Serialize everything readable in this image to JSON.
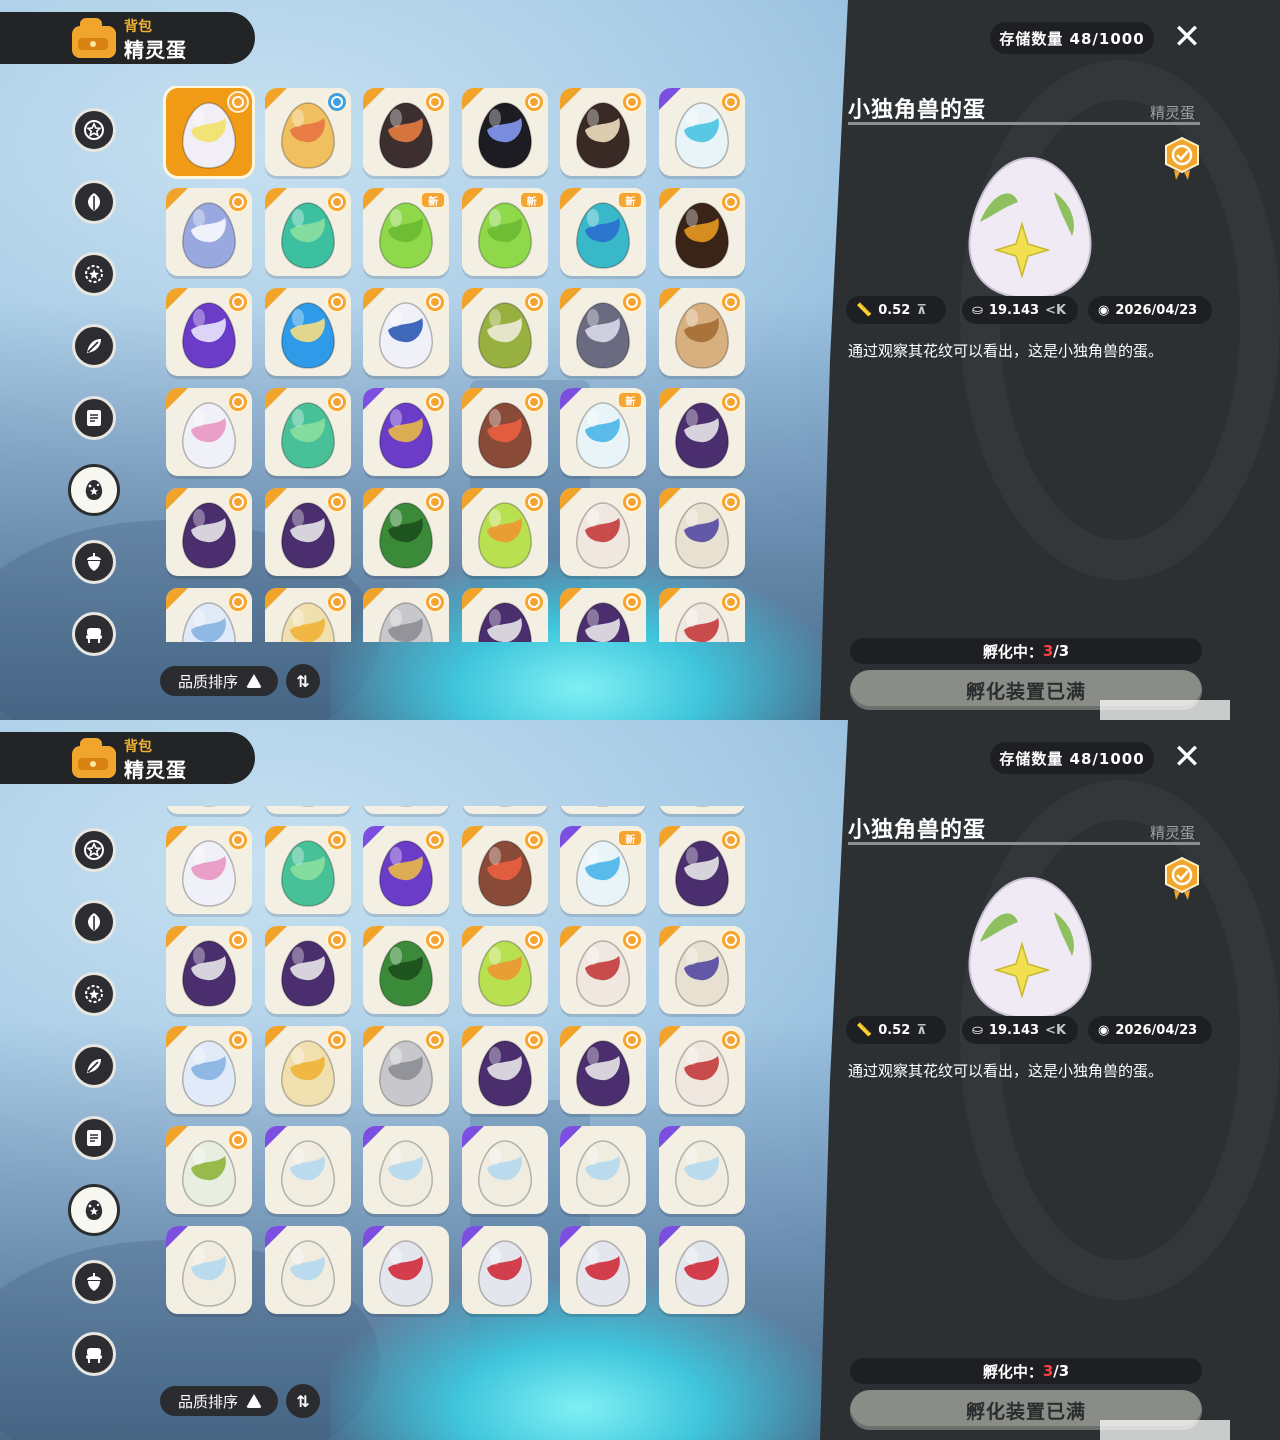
{
  "header": {
    "sub": "背包",
    "title": "精灵蛋"
  },
  "nav": [
    "star-badge",
    "leaf",
    "sun-star",
    "herb",
    "scroll",
    "egg",
    "acorn",
    "chair"
  ],
  "sort": {
    "label": "品质排序"
  },
  "panel": {
    "storage": "存储数量 48/1000",
    "egg_name": "小独角兽的蛋",
    "category": "精灵蛋",
    "size": "0.52",
    "weight": "19.143",
    "date": "2026/04/23",
    "description": "通过观察其花纹可以看出，这是小独角兽的蛋。",
    "hatching_label": "孵化中：",
    "hatching_current": "3",
    "hatching_total": "/3",
    "full_button": "孵化装置已满"
  },
  "screens": [
    {
      "rows": [
        [
          {
            "c": "#f1eef6",
            "s": "#f2e060",
            "m": "o",
            "k": "none"
          },
          {
            "c": "#f0c060",
            "s": "#e87040",
            "m": "b",
            "k": "o"
          },
          {
            "c": "#3d2e30",
            "s": "#f08040",
            "m": "o",
            "k": "o"
          },
          {
            "c": "#1c1c22",
            "s": "#8aa0ff",
            "m": "o",
            "k": "o"
          },
          {
            "c": "#3a2a26",
            "s": "#f8e8c8",
            "m": "o",
            "k": "o"
          },
          {
            "c": "#e8f4f8",
            "s": "#40c0e0",
            "m": "o",
            "k": "p"
          }
        ],
        [
          {
            "c": "#9aa8e0",
            "s": "#ffffff",
            "m": "o",
            "k": "o"
          },
          {
            "c": "#3cc0a0",
            "s": "#8fe0a0",
            "m": "o",
            "k": "o"
          },
          {
            "c": "#8fd84a",
            "s": "#6ab830",
            "m": "n",
            "k": "o"
          },
          {
            "c": "#8fd84a",
            "s": "#6ab830",
            "m": "n",
            "k": "o"
          },
          {
            "c": "#38b8c8",
            "s": "#2a6ad0",
            "m": "n",
            "k": "o"
          },
          {
            "c": "#3a2418",
            "s": "#f0a020",
            "m": "o",
            "k": "o"
          }
        ],
        [
          {
            "c": "#6a3cc8",
            "s": "#f0f0ff",
            "m": "o",
            "k": "o"
          },
          {
            "c": "#2f9ae8",
            "s": "#ffe080",
            "m": "o",
            "k": "o"
          },
          {
            "c": "#f0f0f8",
            "s": "#2050b0",
            "m": "o",
            "k": "o"
          },
          {
            "c": "#98b040",
            "s": "#f0f0e0",
            "m": "o",
            "k": "o"
          },
          {
            "c": "#6a6a80",
            "s": "#e0e0f0",
            "m": "o",
            "k": "o"
          },
          {
            "c": "#d8b080",
            "s": "#a06a30",
            "m": "o",
            "k": "o"
          }
        ],
        [
          {
            "c": "#f0f0f8",
            "s": "#e890c0",
            "m": "o",
            "k": "o"
          },
          {
            "c": "#48c098",
            "s": "#8fe0a0",
            "m": "o",
            "k": "o"
          },
          {
            "c": "#6a3cc8",
            "s": "#f0c040",
            "m": "o",
            "k": "p"
          },
          {
            "c": "#8a4a38",
            "s": "#f06040",
            "m": "o",
            "k": "o"
          },
          {
            "c": "#e8f4f8",
            "s": "#40b0e8",
            "m": "n",
            "k": "p"
          },
          {
            "c": "#4a2e6e",
            "s": "#f0f0f0",
            "m": "o",
            "k": "o"
          }
        ],
        [
          {
            "c": "#4a2e6e",
            "s": "#f0f0f0",
            "m": "o",
            "k": "o"
          },
          {
            "c": "#4a2e6e",
            "s": "#f0f0f0",
            "m": "o",
            "k": "o"
          },
          {
            "c": "#3a8a3a",
            "s": "#1a4a1a",
            "m": "o",
            "k": "o"
          },
          {
            "c": "#b8e050",
            "s": "#f09030",
            "m": "o",
            "k": "o"
          },
          {
            "c": "#f0e8e0",
            "s": "#c03030",
            "m": "o",
            "k": "o"
          },
          {
            "c": "#e8e0d0",
            "s": "#4a40a0",
            "m": "o",
            "k": "o"
          }
        ],
        [
          {
            "c": "#e0eaf8",
            "s": "#80b0e0",
            "m": "o",
            "k": "o"
          },
          {
            "c": "#f0e0b0",
            "s": "#f0b030",
            "m": "o",
            "k": "o"
          },
          {
            "c": "#c8c8cc",
            "s": "#8a8a90",
            "m": "o",
            "k": "o"
          },
          {
            "c": "#4a2e6e",
            "s": "#f0f0f0",
            "m": "o",
            "k": "o"
          },
          {
            "c": "#4a2e6e",
            "s": "#f0f0f0",
            "m": "o",
            "k": "o"
          },
          {
            "c": "#f0e8e0",
            "s": "#c03030",
            "m": "o",
            "k": "o"
          }
        ]
      ]
    },
    {
      "rows": [
        [
          {
            "c": "#6a3cc8",
            "s": "#f0f0ff",
            "m": "none",
            "k": "none"
          },
          {
            "c": "#2f9ae8",
            "s": "#ffe080",
            "m": "none",
            "k": "none"
          },
          {
            "c": "#f0f0f8",
            "s": "#2050b0",
            "m": "none",
            "k": "none"
          },
          {
            "c": "#98b040",
            "s": "#f0f0e0",
            "m": "none",
            "k": "none"
          },
          {
            "c": "#6a6a80",
            "s": "#e0e0f0",
            "m": "none",
            "k": "none"
          },
          {
            "c": "#d8b080",
            "s": "#a06a30",
            "m": "none",
            "k": "none"
          }
        ],
        [
          {
            "c": "#f0f0f8",
            "s": "#e890c0",
            "m": "o",
            "k": "o"
          },
          {
            "c": "#48c098",
            "s": "#8fe0a0",
            "m": "o",
            "k": "o"
          },
          {
            "c": "#6a3cc8",
            "s": "#f0c040",
            "m": "o",
            "k": "p"
          },
          {
            "c": "#8a4a38",
            "s": "#f06040",
            "m": "o",
            "k": "o"
          },
          {
            "c": "#e8f4f8",
            "s": "#40b0e8",
            "m": "n",
            "k": "p"
          },
          {
            "c": "#4a2e6e",
            "s": "#f0f0f0",
            "m": "o",
            "k": "o"
          }
        ],
        [
          {
            "c": "#4a2e6e",
            "s": "#f0f0f0",
            "m": "o",
            "k": "o"
          },
          {
            "c": "#4a2e6e",
            "s": "#f0f0f0",
            "m": "o",
            "k": "o"
          },
          {
            "c": "#3a8a3a",
            "s": "#1a4a1a",
            "m": "o",
            "k": "o"
          },
          {
            "c": "#b8e050",
            "s": "#f09030",
            "m": "o",
            "k": "o"
          },
          {
            "c": "#f0e8e0",
            "s": "#c03030",
            "m": "o",
            "k": "o"
          },
          {
            "c": "#e8e0d0",
            "s": "#4a40a0",
            "m": "o",
            "k": "o"
          }
        ],
        [
          {
            "c": "#e0eaf8",
            "s": "#80b0e0",
            "m": "o",
            "k": "o"
          },
          {
            "c": "#f0e0b0",
            "s": "#f0b030",
            "m": "o",
            "k": "o"
          },
          {
            "c": "#c8c8cc",
            "s": "#8a8a90",
            "m": "o",
            "k": "o"
          },
          {
            "c": "#4a2e6e",
            "s": "#f0f0f0",
            "m": "o",
            "k": "o"
          },
          {
            "c": "#4a2e6e",
            "s": "#f0f0f0",
            "m": "o",
            "k": "o"
          },
          {
            "c": "#f0e8e0",
            "s": "#c03030",
            "m": "o",
            "k": "o"
          }
        ],
        [
          {
            "c": "#e8eee0",
            "s": "#8ab030",
            "m": "o",
            "k": "o"
          },
          {
            "c": "#f0ece0",
            "s": "#b0d8f0",
            "m": "none",
            "k": "p"
          },
          {
            "c": "#f0ece0",
            "s": "#b0d8f0",
            "m": "none",
            "k": "p"
          },
          {
            "c": "#f0ece0",
            "s": "#b0d8f0",
            "m": "none",
            "k": "p"
          },
          {
            "c": "#f0ece0",
            "s": "#b0d8f0",
            "m": "none",
            "k": "p"
          },
          {
            "c": "#f0ece0",
            "s": "#b0d8f0",
            "m": "none",
            "k": "p"
          }
        ],
        [
          {
            "c": "#f0ece0",
            "s": "#b0d8f0",
            "m": "none",
            "k": "p"
          },
          {
            "c": "#f0ece0",
            "s": "#b0d8f0",
            "m": "none",
            "k": "p"
          },
          {
            "c": "#e4e6ee",
            "s": "#d02030",
            "m": "none",
            "k": "p"
          },
          {
            "c": "#e4e6ee",
            "s": "#d02030",
            "m": "none",
            "k": "p"
          },
          {
            "c": "#e4e6ee",
            "s": "#d02030",
            "m": "none",
            "k": "p"
          },
          {
            "c": "#e4e6ee",
            "s": "#d02030",
            "m": "none",
            "k": "p"
          }
        ]
      ]
    }
  ]
}
